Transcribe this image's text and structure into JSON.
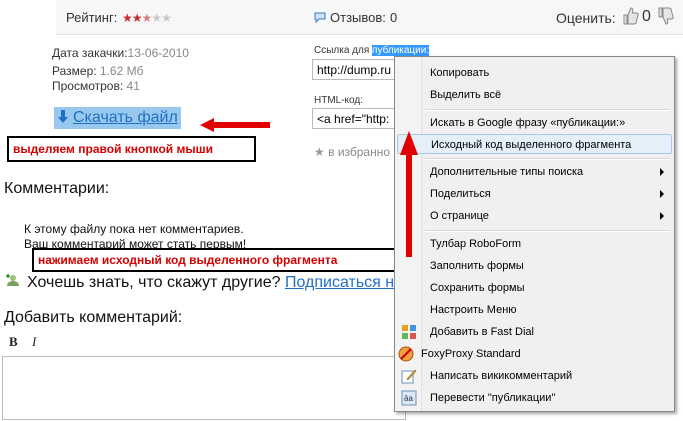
{
  "topbar": {
    "rating_label": "Рейтинг:",
    "rating_value": 2.5,
    "rating_max": 5,
    "reviews_label": "Отзывов:",
    "reviews_count": "0",
    "rate_label": "Оценить:",
    "rate_count": "0"
  },
  "file": {
    "date_label": "Дата закачки:",
    "date_value": "13-06-2010",
    "size_label": "Размер:",
    "size_value": "1.62 Мб",
    "views_label": "Просмотров:",
    "views_value": "41",
    "download_label": "Скачать файл"
  },
  "links": {
    "publish_label_prefix": "Ссылка для ",
    "publish_label_selected": "публикации:",
    "publish_value": "http://dump.ru",
    "html_label": "HTML-код:",
    "html_value": "<a href=\"http:",
    "favorites_label": "в избранно"
  },
  "annotations": {
    "right_click": "выделяем правой кнопкой мыши",
    "source_code": "нажимаем исходный код выделенного фрагмента"
  },
  "comments": {
    "heading": "Комментарии:",
    "empty_line1": "К этому файлу пока нет комментариев.",
    "empty_line2": "Ваш комментарий может стать первым!",
    "subscribe_question": "Хочешь знать, что скажут другие?",
    "subscribe_link": "Подписаться на",
    "add_heading": "Добавить комментарий:",
    "bold_btn": "B",
    "italic_btn": "I"
  },
  "context_menu": {
    "items": [
      {
        "label": "Копировать"
      },
      {
        "label": "Выделить всё"
      },
      {
        "label": "Искать в Google фразу «публикации:»"
      },
      {
        "label": "Исходный код выделенного фрагмента"
      },
      {
        "label": "Дополнительные типы поиска"
      },
      {
        "label": "Поделиться"
      },
      {
        "label": "О странице"
      },
      {
        "label": "Тулбар RoboForm"
      },
      {
        "label": "Заполнить формы"
      },
      {
        "label": "Сохранить формы"
      },
      {
        "label": "Настроить Меню"
      },
      {
        "label": "Добавить в Fast Dial"
      },
      {
        "label": "FoxyProxy Standard"
      },
      {
        "label": "Написать викикомментарий"
      },
      {
        "label": "Перевести \"публикации\""
      }
    ]
  },
  "colors": {
    "annotation_red": "#d60000",
    "link_blue": "#1f6fc5",
    "selection_bg": "#99c8ef"
  }
}
